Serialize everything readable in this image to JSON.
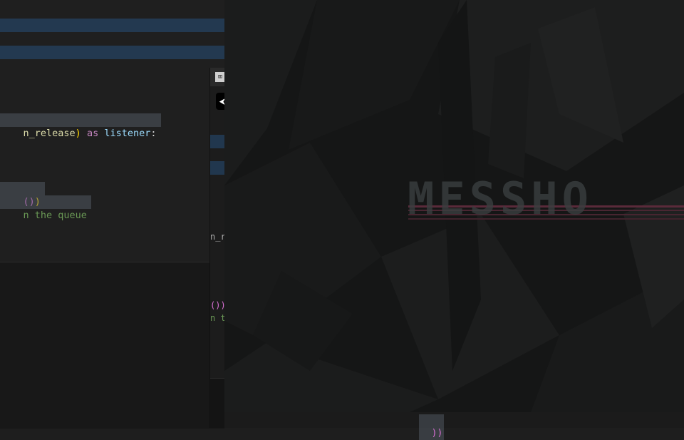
{
  "editor": {
    "line_with_listener": {
      "func_tail": "n_release",
      "close_paren": ")",
      "keyword": "as",
      "var": "listener",
      "colon": ":"
    },
    "line_call_parens": {
      "inner": "()",
      "outer": ")"
    },
    "line_comment": "n the queue"
  },
  "mid_window": {
    "back_arrow": "⮜",
    "app_icon": "⌧",
    "frag_release": "n_r",
    "frag_parens": "())",
    "frag_comment": "n t"
  },
  "overlay": {
    "logo_text": "MESSHO",
    "accent_colors": [
      "#5a2a3a",
      "#3a3f40"
    ]
  },
  "bottom": {
    "frag_parens": "))"
  }
}
